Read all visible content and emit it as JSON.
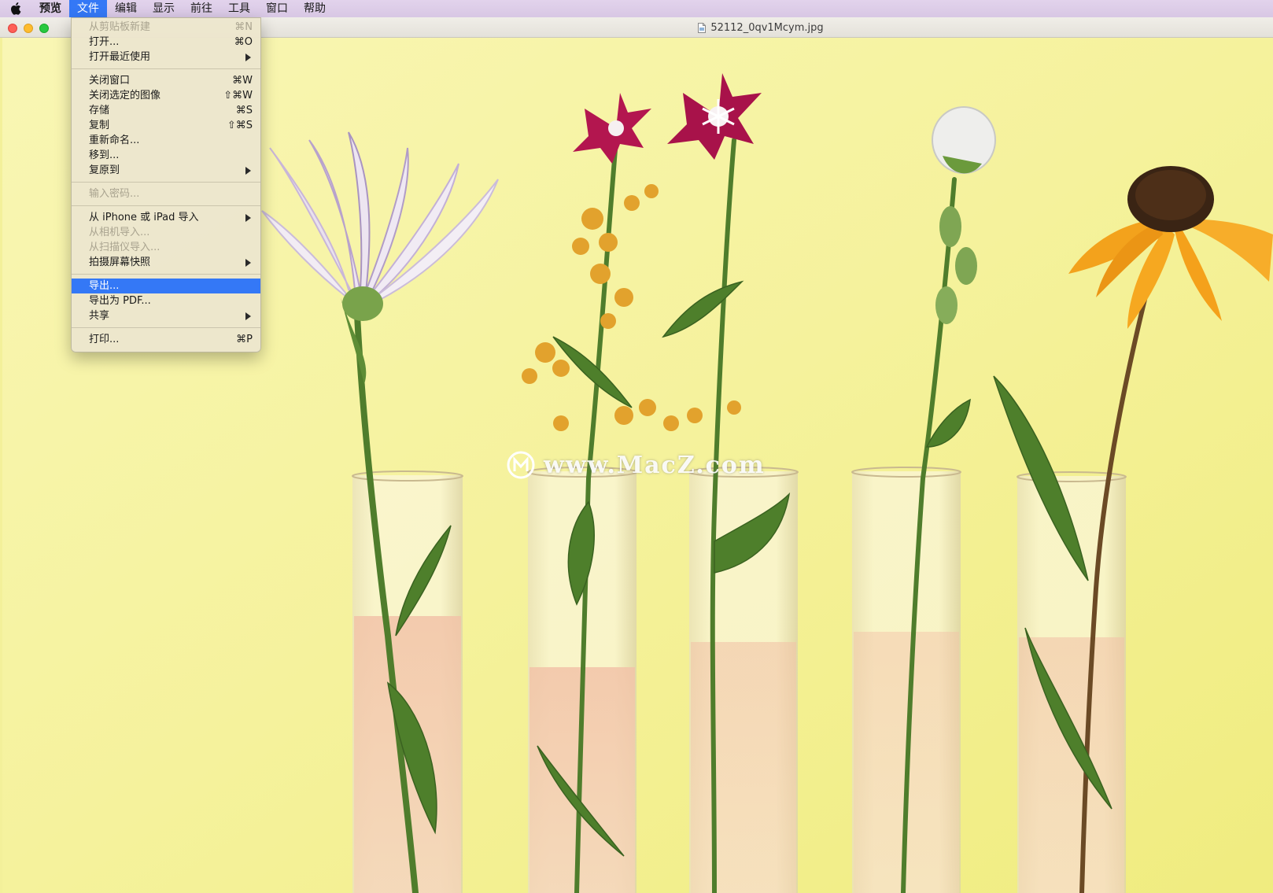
{
  "menubar": {
    "apple_icon": "apple-icon",
    "items": [
      "预览",
      "文件",
      "编辑",
      "显示",
      "前往",
      "工具",
      "窗口",
      "帮助"
    ],
    "active_item": "文件",
    "highlight_color": "#3478f6"
  },
  "window": {
    "title": "52112_0qv1Mcym.jpg",
    "doc_icon": "image-file-icon"
  },
  "file_menu": {
    "new_from_clipboard": {
      "label": "从剪贴板新建",
      "shortcut": "⌘N"
    },
    "open": {
      "label": "打开...",
      "shortcut": "⌘O"
    },
    "open_recent": {
      "label": "打开最近使用"
    },
    "close_window": {
      "label": "关闭窗口",
      "shortcut": "⌘W"
    },
    "close_selected": {
      "label": "关闭选定的图像",
      "shortcut": "⇧⌘W"
    },
    "save": {
      "label": "存储",
      "shortcut": "⌘S"
    },
    "duplicate": {
      "label": "复制",
      "shortcut": "⇧⌘S"
    },
    "rename": {
      "label": "重新命名..."
    },
    "move_to": {
      "label": "移到..."
    },
    "revert_to": {
      "label": "复原到"
    },
    "enter_password": {
      "label": "输入密码..."
    },
    "import_iphone": {
      "label": "从 iPhone 或 iPad 导入"
    },
    "import_camera": {
      "label": "从相机导入..."
    },
    "import_scanner": {
      "label": "从扫描仪导入..."
    },
    "screenshot": {
      "label": "拍摄屏幕快照"
    },
    "export": {
      "label": "导出..."
    },
    "export_pdf": {
      "label": "导出为 PDF..."
    },
    "share": {
      "label": "共享"
    },
    "print": {
      "label": "打印...",
      "shortcut": "⌘P"
    }
  },
  "image": {
    "watermark": "www.MacZ.com",
    "background_color": "#f5f29c"
  }
}
